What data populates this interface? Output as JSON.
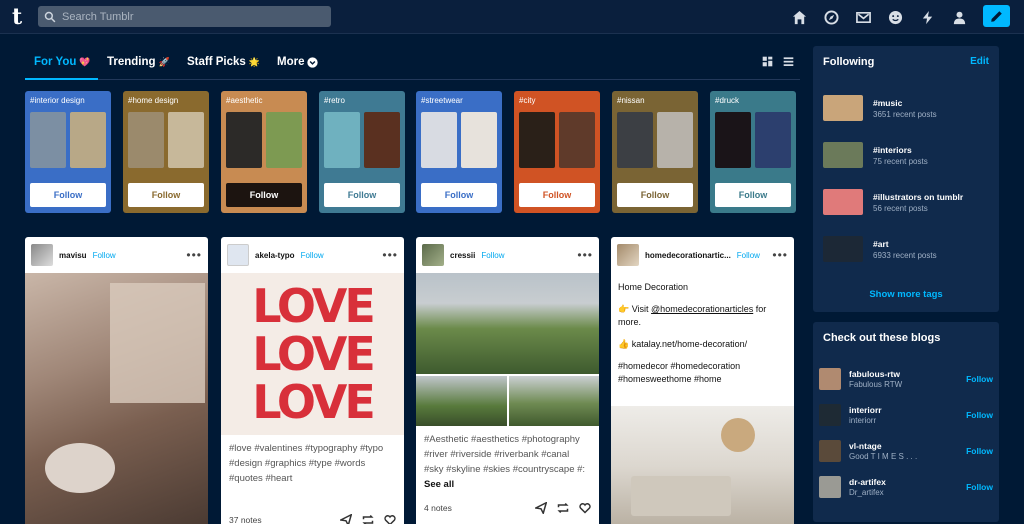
{
  "header": {
    "logo": "t",
    "search_placeholder": "Search Tumblr",
    "icons": [
      "home-icon",
      "explore-icon",
      "inbox-icon",
      "messages-icon",
      "activity-icon",
      "account-icon",
      "compose-icon"
    ]
  },
  "tabs": [
    {
      "label": "For You",
      "emoji": "💖"
    },
    {
      "label": "Trending",
      "emoji": "🚀"
    },
    {
      "label": "Staff Picks",
      "emoji": "🌟"
    },
    {
      "label": "More",
      "emoji": ""
    }
  ],
  "tag_cards": [
    {
      "tag": "#interior design",
      "bg": "#3a6ec6",
      "btn_color": "#3a6ec6",
      "follow": "Follow",
      "thumbs": [
        "#7c8fa3",
        "#b8a887"
      ]
    },
    {
      "tag": "#home design",
      "bg": "#8a6a2e",
      "btn_color": "#8a6a2e",
      "follow": "Follow",
      "thumbs": [
        "#9b8a6c",
        "#c7b89a"
      ]
    },
    {
      "tag": "#aesthetic",
      "bg": "#c88b52",
      "btn_color": "#ffffff",
      "btn_bg": "#1c1410",
      "follow": "Follow",
      "thumbs": [
        "#2c2a28",
        "#7d9a52"
      ]
    },
    {
      "tag": "#retro",
      "bg": "#3f7a93",
      "btn_color": "#3f7a93",
      "follow": "Follow",
      "thumbs": [
        "#6fb1bf",
        "#5a3020"
      ]
    },
    {
      "tag": "#streetwear",
      "bg": "#3a6ec6",
      "btn_color": "#3a6ec6",
      "follow": "Follow",
      "thumbs": [
        "#d8dbe2",
        "#e7e2dc"
      ]
    },
    {
      "tag": "#city",
      "bg": "#d05324",
      "btn_color": "#d05324",
      "follow": "Follow",
      "thumbs": [
        "#2a2018",
        "#5f3a2a"
      ]
    },
    {
      "tag": "#nissan",
      "bg": "#7a6434",
      "btn_color": "#7a6434",
      "follow": "Follow",
      "thumbs": [
        "#3c3f44",
        "#b7b2aa"
      ]
    },
    {
      "tag": "#druck",
      "bg": "#3a7a8a",
      "btn_color": "#3a7a8a",
      "follow": "Follow",
      "thumbs": [
        "#1a1418",
        "#2c3f6e"
      ]
    }
  ],
  "posts": [
    {
      "user": "mavisu",
      "follow": "Follow"
    },
    {
      "user": "akela-typo",
      "follow": "Follow",
      "image_text": [
        "LOVE",
        "LOVE",
        "LOVE"
      ],
      "tags": "#love  #valentines  #typography  #typo  #design  #graphics  #type  #words  #quotes  #heart",
      "notes": "37 notes"
    },
    {
      "user": "cressii",
      "follow": "Follow",
      "tags": "#Aesthetic  #aesthetics  #photography  #river  #riverside  #riverbank  #canal  #sky  #skyline  #skies  #countryscape  #:",
      "see_all": "See all",
      "notes": "4 notes"
    },
    {
      "user": "homedecorationartic...",
      "follow": "Follow",
      "title": "Home Decoration",
      "line1_prefix": "👉  Visit ",
      "line1_link": "@homedecorationarticles",
      "line1_suffix": " for more.",
      "line2": "👍  katalay.net/home-decoration/",
      "tags": "#homedecor #homedecoration #homesweethome #home"
    }
  ],
  "following": {
    "title": "Following",
    "edit": "Edit",
    "items": [
      {
        "name": "#music",
        "count": "3651 recent posts",
        "color": "#c9a57a"
      },
      {
        "name": "#interiors",
        "count": "75 recent posts",
        "color": "#6b7a5a"
      },
      {
        "name": "#illustrators on tumblr",
        "count": "56 recent posts",
        "color": "#e07a7a"
      },
      {
        "name": "#art",
        "count": "6933 recent posts",
        "color": "#1c2836"
      }
    ],
    "show_more": "Show more tags"
  },
  "blogs": {
    "title": "Check out these blogs",
    "items": [
      {
        "name": "fabulous-rtw",
        "sub": "Fabulous RTW",
        "follow": "Follow",
        "color": "#b08a70"
      },
      {
        "name": "interiorr",
        "sub": "interiorr",
        "follow": "Follow",
        "color": "#1e2a34"
      },
      {
        "name": "vl-ntage",
        "sub": "Good T I M E S . . .",
        "follow": "Follow",
        "color": "#5a4a3a"
      },
      {
        "name": "dr-artifex",
        "sub": "Dr_artifex",
        "follow": "Follow",
        "color": "#9a9a94"
      }
    ]
  },
  "colors": {
    "accent": "#00b8ff",
    "bg": "#001935"
  }
}
